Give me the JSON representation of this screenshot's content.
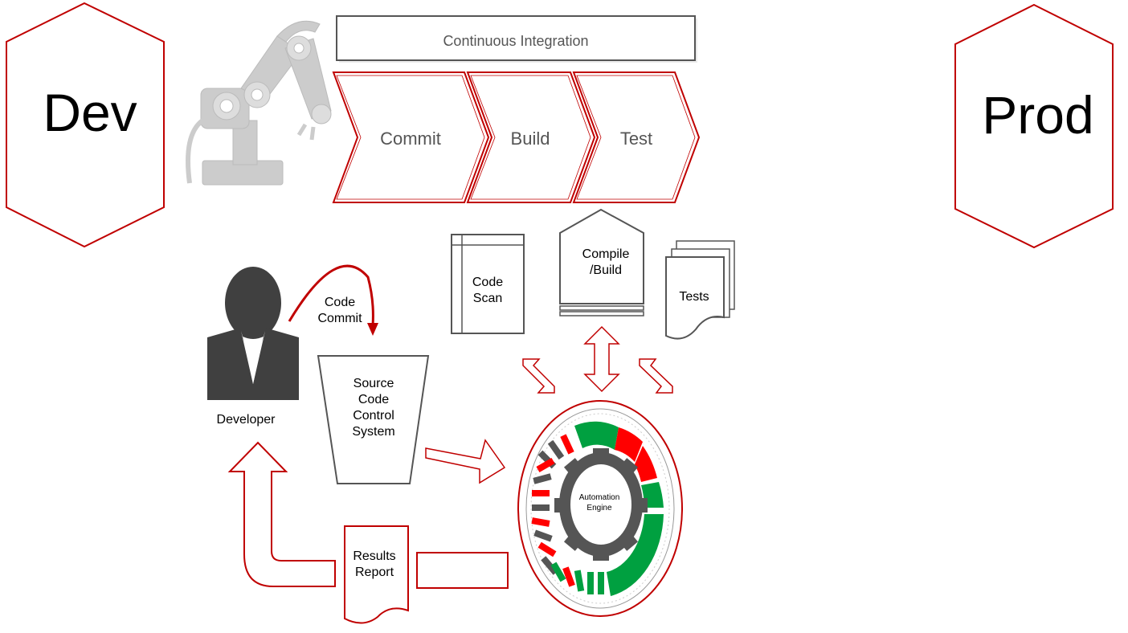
{
  "stages": {
    "dev": "Dev",
    "prod": "Prod"
  },
  "ci": {
    "title": "Continuous Integration",
    "steps": [
      "Commit",
      "Build",
      "Test"
    ]
  },
  "developer": {
    "label": "Developer"
  },
  "code_commit": {
    "line1": "Code",
    "line2": "Commit"
  },
  "source_control": {
    "lines": [
      "Source",
      "Code",
      "Control",
      "System"
    ]
  },
  "code_scan": {
    "lines": [
      "Code",
      "Scan"
    ]
  },
  "compile_build": {
    "lines": [
      "Compile",
      "/Build"
    ]
  },
  "tests": {
    "label": "Tests"
  },
  "automation_engine": {
    "lines": [
      "Automation",
      "Engine"
    ]
  },
  "results_report": {
    "lines": [
      "Results",
      "Report"
    ]
  },
  "colors": {
    "accent_red": "#c00000",
    "gauge_green": "#00a040",
    "gauge_red": "#ff0000",
    "gauge_gray": "#555555",
    "robot_gray": "#cccccc",
    "person_gray": "#404040"
  }
}
